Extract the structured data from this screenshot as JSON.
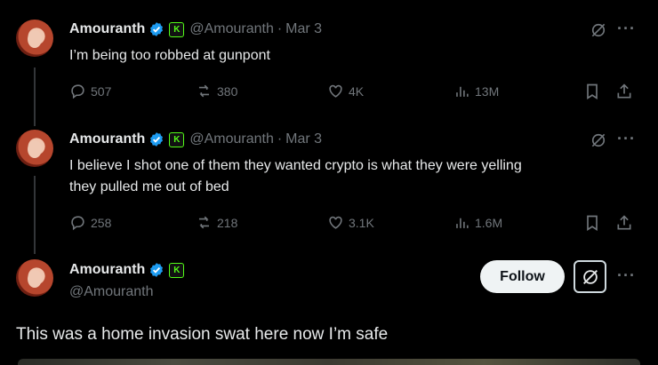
{
  "colors": {
    "background": "#000000",
    "text": "#e7e9ea",
    "muted": "#71767b",
    "verified": "#1d9bf0",
    "kick": "#53fc18"
  },
  "tweets": [
    {
      "name": "Amouranth",
      "handle": "@Amouranth",
      "separator": "·",
      "date": "Mar 3",
      "text": "I’m being too robbed at gunpont",
      "replies": "507",
      "reposts": "380",
      "likes": "4K",
      "views": "13M"
    },
    {
      "name": "Amouranth",
      "handle": "@Amouranth",
      "separator": "·",
      "date": "Mar 3",
      "text_line1": "I believe I shot one of them they wanted crypto is what they were yelling",
      "text_line2": "they pulled me out of bed",
      "replies": "258",
      "reposts": "218",
      "likes": "3.1K",
      "views": "1.6M"
    }
  ],
  "main_tweet": {
    "name": "Amouranth",
    "handle": "@Amouranth",
    "follow_label": "Follow",
    "text": "This was a home invasion swat here now I’m safe"
  },
  "icons": {
    "verified": "verified-badge-icon",
    "kick": "kick-badge-icon",
    "grok": "grok-icon",
    "more": "more-icon",
    "reply": "reply-icon",
    "repost": "repost-icon",
    "like": "like-icon",
    "views": "views-icon",
    "bookmark": "bookmark-icon",
    "share": "share-icon"
  },
  "more_glyph": "···",
  "kick_glyph": "K"
}
